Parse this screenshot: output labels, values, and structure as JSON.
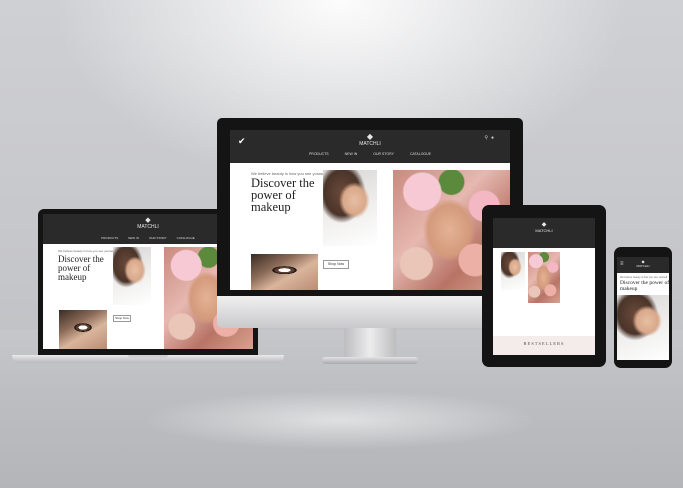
{
  "site": {
    "brand": "MATCHLI",
    "nav": [
      "PRODUCTS",
      "NEW IN",
      "OUR STORY",
      "CATALOGUE"
    ],
    "tagline": "We believe beauty is how you see yourself",
    "headline_l1": "Discover the",
    "headline_l2": "power of",
    "headline_l3": "makeup",
    "cta": "Shop Now",
    "bestsellers": "BESTSELLERS"
  }
}
